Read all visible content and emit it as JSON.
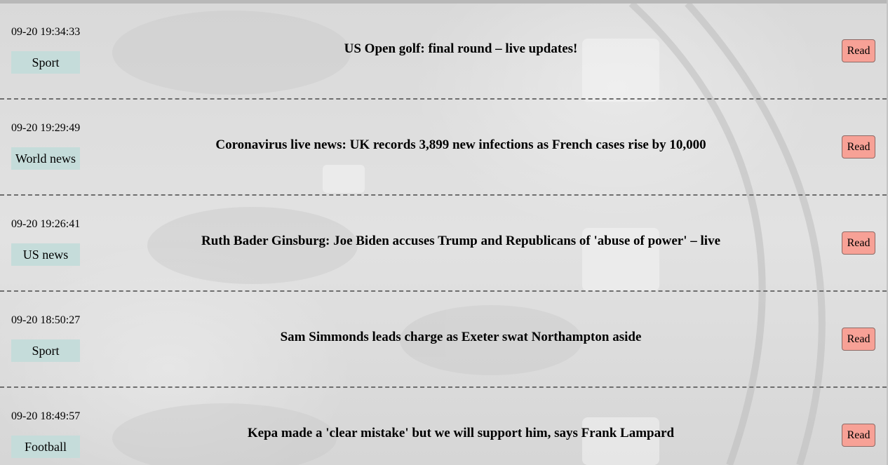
{
  "news": [
    {
      "time": "09-20 19:34:33",
      "category": "Sport",
      "headline": "US Open golf: final round – live updates!",
      "action": "Read"
    },
    {
      "time": "09-20 19:29:49",
      "category": "World news",
      "headline": "Coronavirus live news: UK records 3,899 new infections as French cases rise by 10,000",
      "action": "Read"
    },
    {
      "time": "09-20 19:26:41",
      "category": "US news",
      "headline": "Ruth Bader Ginsburg: Joe Biden accuses Trump and Republicans of 'abuse of power' – live",
      "action": "Read"
    },
    {
      "time": "09-20 18:50:27",
      "category": "Sport",
      "headline": "Sam Simmonds leads charge as Exeter swat Northampton aside",
      "action": "Read"
    },
    {
      "time": "09-20 18:49:57",
      "category": "Football",
      "headline": "Kepa made a 'clear mistake' but we will support him, says Frank Lampard",
      "action": "Read"
    }
  ],
  "colors": {
    "category_badge": "#c5dcda",
    "read_button": "#f7a196",
    "divider": "#6e6e6e"
  }
}
